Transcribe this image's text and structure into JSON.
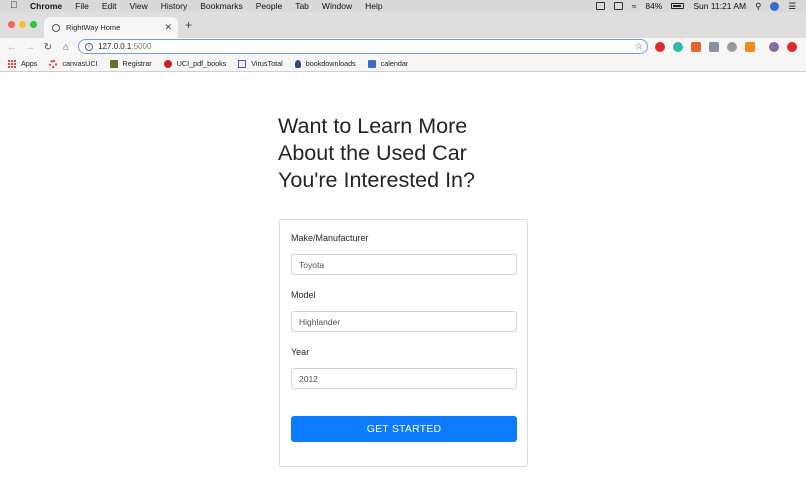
{
  "menubar": {
    "app_name": "Chrome",
    "items": [
      "File",
      "Edit",
      "View",
      "History",
      "Bookmarks",
      "People",
      "Tab",
      "Window",
      "Help"
    ],
    "battery": "84%",
    "clock": "Sun 11:21 AM"
  },
  "browser": {
    "tab_title": "RightWay Home",
    "url_host": "127.0.0.1",
    "url_port": ":5000"
  },
  "bookmarks": [
    {
      "label": "Apps",
      "icon": "apps-grid-icon",
      "color": "#d44444"
    },
    {
      "label": "canvasUCI",
      "icon": "canvas-icon",
      "color": "#e03a3a"
    },
    {
      "label": "Registrar",
      "icon": "registrar-icon",
      "color": "#6b6b2b"
    },
    {
      "label": "UCI_pdf_books",
      "icon": "pdf-books-icon",
      "color": "#d02020"
    },
    {
      "label": "VirusTotal",
      "icon": "virustotal-icon",
      "color": "#3a5bd0"
    },
    {
      "label": "bookdownloads",
      "icon": "bookdownloads-icon",
      "color": "#2b4a8a"
    },
    {
      "label": "calendar",
      "icon": "calendar-icon",
      "color": "#3a6bd0"
    }
  ],
  "page": {
    "heading_lines": [
      "Want to Learn More",
      "About the Used Car",
      "You're Interested In?"
    ],
    "form": {
      "make_label": "Make/Manufacturer",
      "make_value": "Toyota",
      "model_label": "Model",
      "model_value": "Highlander",
      "year_label": "Year",
      "year_value": "2012",
      "submit_label": "GET STARTED"
    }
  },
  "colors": {
    "primary_button": "#0d7bff",
    "omnibox_focus": "#6b9ee8"
  }
}
